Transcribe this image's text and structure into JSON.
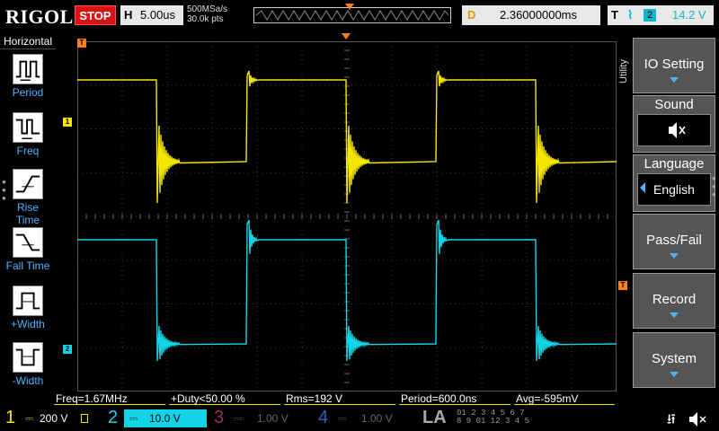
{
  "header": {
    "brand": "RIGOL",
    "run_state": "STOP",
    "timebase_label": "H",
    "timebase_value": "5.00us",
    "sample_rate": "500MSa/s",
    "memory_depth": "30.0k pts",
    "delay_label": "D",
    "delay_value": "2.36000000ms",
    "trigger_label": "T",
    "trigger_source": "2",
    "trigger_level": "14.2 V"
  },
  "left_menu": {
    "title": "Horizontal",
    "items": [
      {
        "label": "Period"
      },
      {
        "label": "Freq"
      },
      {
        "label": "Rise Time"
      },
      {
        "label": "Fall Time"
      },
      {
        "label": "+Width"
      },
      {
        "label": "-Width"
      }
    ]
  },
  "markers": {
    "ch1": "1",
    "ch2": "2",
    "time": "T",
    "trigger": "T"
  },
  "right_menu": {
    "side_label": "Utility",
    "io_setting": "IO Setting",
    "sound": "Sound",
    "language": "Language",
    "language_value": "English",
    "pass_fail": "Pass/Fail",
    "record": "Record",
    "system": "System"
  },
  "measurements": [
    {
      "text": "Freq=1.67MHz"
    },
    {
      "text": "+Duty<50.00 %"
    },
    {
      "text": "Rms=192 V"
    },
    {
      "text": "Period=600.0ns"
    },
    {
      "text": "Avg=-595mV"
    }
  ],
  "channels": [
    {
      "num": "1",
      "scale": "200 V",
      "color": "#f5e600"
    },
    {
      "num": "2",
      "scale": "10.0 V",
      "color": "#13d4e6"
    },
    {
      "num": "3",
      "scale": "1.00 V",
      "color": "#a0266e"
    },
    {
      "num": "4",
      "scale": "1.00 V",
      "color": "#3a5ac8"
    }
  ],
  "logic_analyzer": {
    "label": "LA",
    "digits_row1": "01 2 3   4 5 6 7",
    "digits_row2": "8 9 01   12 3 4 5"
  },
  "colors": {
    "ch1": "#f5e600",
    "ch2": "#13d4e6",
    "accent": "#4db3ff",
    "trigger": "#ff7f1a",
    "stop": "#d81515"
  }
}
